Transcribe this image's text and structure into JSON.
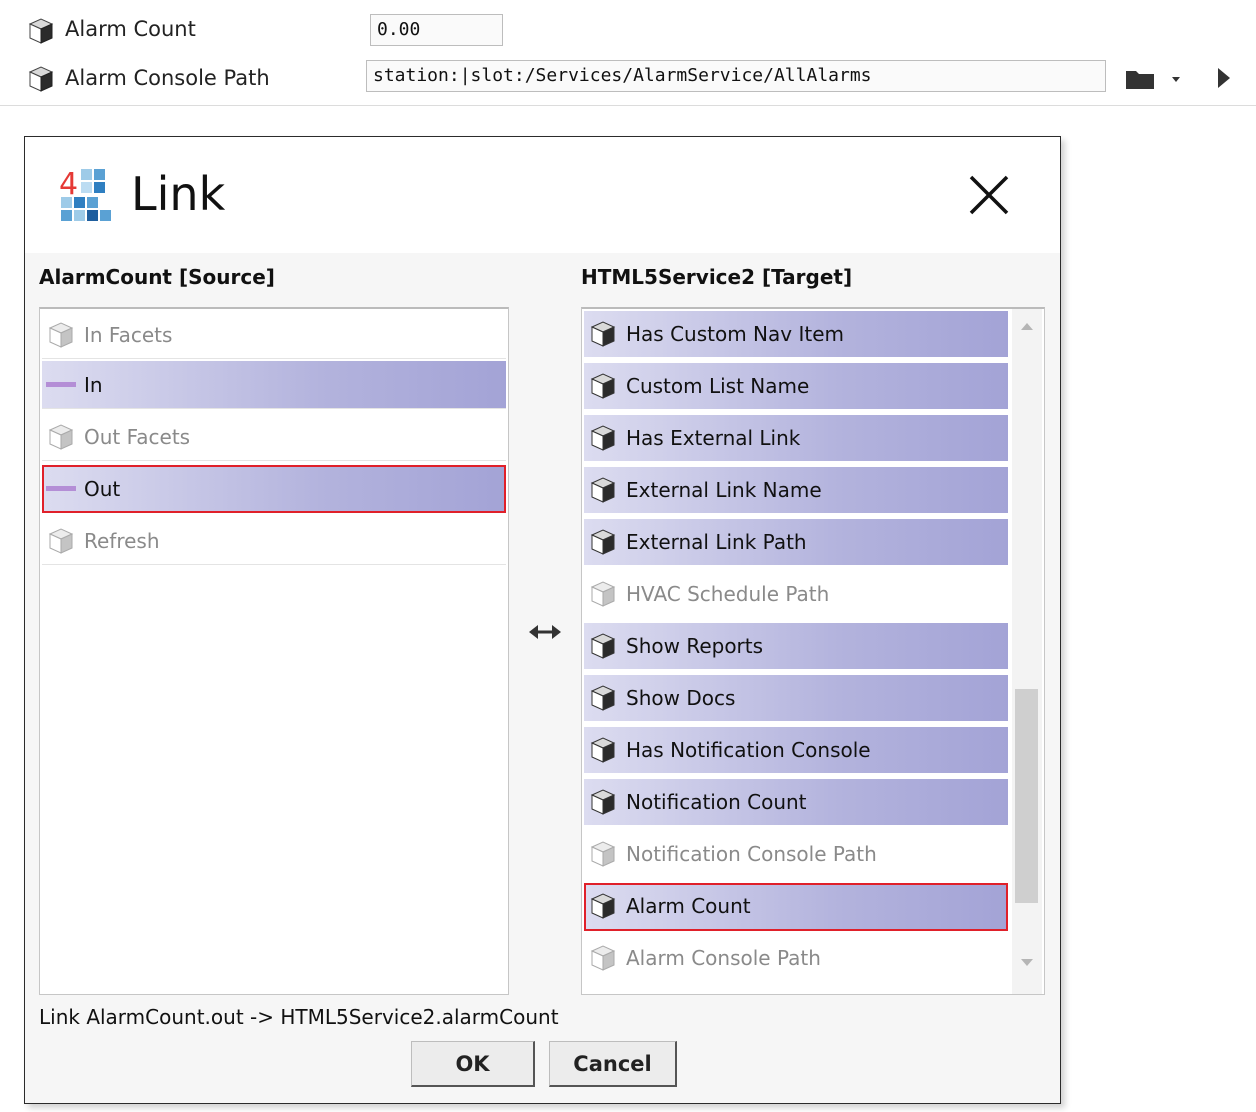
{
  "properties": {
    "alarm_count": {
      "label": "Alarm Count",
      "value": "0.00",
      "icon": "component-cube-icon"
    },
    "alarm_console_path": {
      "label": "Alarm Console Path",
      "value": "station:|slot:/Services/AlarmService/AllAlarms",
      "icon": "component-cube-icon"
    }
  },
  "toolbar_icons": {
    "folder": "folder-dropdown-icon",
    "arrow": "play-arrow-icon"
  },
  "dialog": {
    "title": "Link",
    "logo": "niagara-4-logo",
    "close_icon": "close-x-icon",
    "source": {
      "title": "AlarmCount [Source]",
      "items": [
        {
          "label": "In Facets",
          "icon": "component-cube-icon",
          "state": "disabled"
        },
        {
          "label": "In",
          "icon": "slot-bar-icon",
          "state": "linkable"
        },
        {
          "label": "Out Facets",
          "icon": "component-cube-icon",
          "state": "disabled"
        },
        {
          "label": "Out",
          "icon": "slot-bar-icon",
          "state": "selected"
        },
        {
          "label": "Refresh",
          "icon": "component-cube-icon",
          "state": "disabled"
        }
      ]
    },
    "swap_icon": "swap-arrows-icon",
    "target": {
      "title": "HTML5Service2 [Target]",
      "items": [
        {
          "label": "Has Custom Nav Item",
          "icon": "component-cube-icon",
          "state": "linkable"
        },
        {
          "label": "Custom List Name",
          "icon": "component-cube-icon",
          "state": "linkable"
        },
        {
          "label": "Has External Link",
          "icon": "component-cube-icon",
          "state": "linkable"
        },
        {
          "label": "External Link Name",
          "icon": "component-cube-icon",
          "state": "linkable"
        },
        {
          "label": "External Link Path",
          "icon": "component-cube-icon",
          "state": "linkable"
        },
        {
          "label": "HVAC Schedule Path",
          "icon": "component-cube-icon",
          "state": "disabled"
        },
        {
          "label": "Show Reports",
          "icon": "component-cube-icon",
          "state": "linkable"
        },
        {
          "label": "Show Docs",
          "icon": "component-cube-icon",
          "state": "linkable"
        },
        {
          "label": "Has Notification Console",
          "icon": "component-cube-icon",
          "state": "linkable"
        },
        {
          "label": "Notification Count",
          "icon": "component-cube-icon",
          "state": "linkable"
        },
        {
          "label": "Notification Console Path",
          "icon": "component-cube-icon",
          "state": "disabled"
        },
        {
          "label": "Alarm Count",
          "icon": "component-cube-icon",
          "state": "selected"
        },
        {
          "label": "Alarm Console Path",
          "icon": "component-cube-icon",
          "state": "disabled"
        }
      ]
    },
    "link_expression": "Link AlarmCount.out -> HTML5Service2.alarmCount",
    "buttons": {
      "ok": "OK",
      "cancel": "Cancel"
    }
  },
  "colors": {
    "linkable_gradient_start": "#dcdcf0",
    "linkable_gradient_end": "#a3a3d6",
    "selection_outline": "#e0202a",
    "slot_bar": "#b48ed6"
  }
}
